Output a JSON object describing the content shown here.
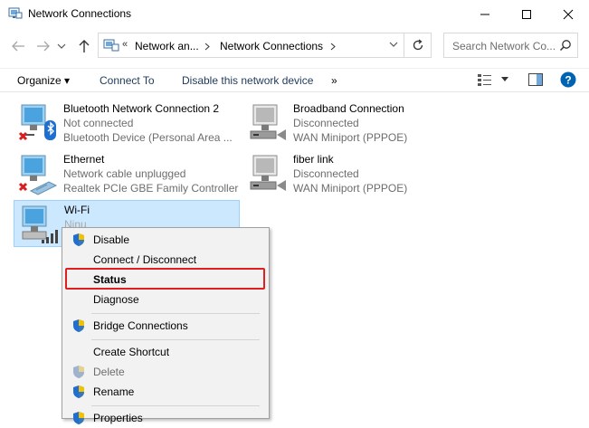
{
  "window": {
    "title": "Network Connections",
    "icon": "network-folder-icon"
  },
  "address": {
    "overflow": "«",
    "crumbs": [
      "Network an...",
      "Network Connections"
    ],
    "search_placeholder": "Search Network Co..."
  },
  "commands": {
    "organize": "Organize",
    "organize_arrow": "▾",
    "connect_to": "Connect To",
    "disable_device": "Disable this network device",
    "more": "»"
  },
  "connections": [
    {
      "name": "Bluetooth Network Connection 2",
      "status": "Not connected",
      "device": "Bluetooth Device (Personal Area ..."
    },
    {
      "name": "Broadband Connection",
      "status": "Disconnected",
      "device": "WAN Miniport (PPPOE)"
    },
    {
      "name": "Ethernet",
      "status": "Network cable unplugged",
      "device": "Realtek PCIe GBE Family Controller"
    },
    {
      "name": "fiber link",
      "status": "Disconnected",
      "device": "WAN Miniport (PPPOE)"
    },
    {
      "name": "Wi-Fi",
      "status": "Ninu",
      "device": ""
    }
  ],
  "context_menu": {
    "disable": "Disable",
    "connect_disconnect": "Connect / Disconnect",
    "status": "Status",
    "diagnose": "Diagnose",
    "bridge": "Bridge Connections",
    "create_shortcut": "Create Shortcut",
    "delete": "Delete",
    "rename": "Rename",
    "properties": "Properties"
  },
  "colors": {
    "accent": "#0078d7",
    "selection": "#cce8ff",
    "highlight_box": "#e02020",
    "error_x": "#d81e1e"
  }
}
